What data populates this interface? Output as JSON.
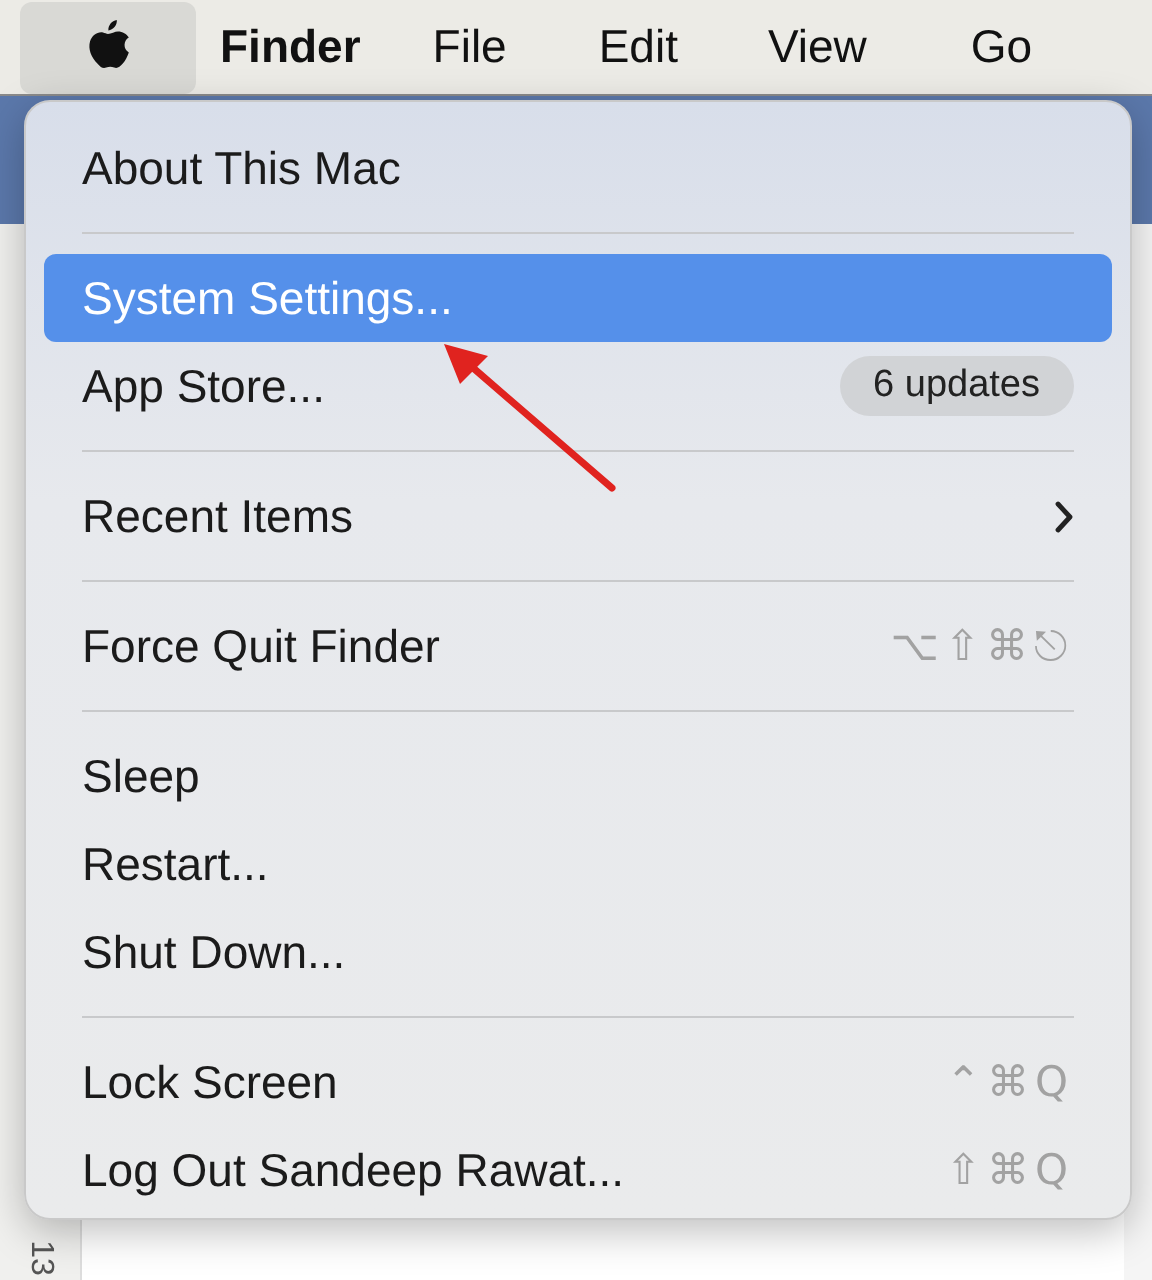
{
  "menu_bar": {
    "items": [
      {
        "label": "Finder",
        "kind": "app"
      },
      {
        "label": "File",
        "kind": "menu"
      },
      {
        "label": "Edit",
        "kind": "menu"
      },
      {
        "label": "View",
        "kind": "menu"
      },
      {
        "label": "Go",
        "kind": "menu"
      }
    ]
  },
  "background_window": {
    "ruler_labels": [
      "13"
    ]
  },
  "apple_menu": {
    "sections": [
      [
        {
          "label": "About This Mac",
          "kind": "plain",
          "selected": false
        }
      ],
      [
        {
          "label": "System Settings...",
          "kind": "plain",
          "selected": true
        },
        {
          "label": "App Store...",
          "kind": "badge",
          "badge": "6 updates",
          "selected": false
        }
      ],
      [
        {
          "label": "Recent Items",
          "kind": "submenu",
          "selected": false
        }
      ],
      [
        {
          "label": "Force Quit Finder",
          "kind": "shortcut",
          "shortcut": "⌥⇧⌘⎋",
          "selected": false
        }
      ],
      [
        {
          "label": "Sleep",
          "kind": "plain",
          "selected": false
        },
        {
          "label": "Restart...",
          "kind": "plain",
          "selected": false
        },
        {
          "label": "Shut Down...",
          "kind": "plain",
          "selected": false
        }
      ],
      [
        {
          "label": "Lock Screen",
          "kind": "shortcut",
          "shortcut": "⌃⌘Q",
          "selected": false
        },
        {
          "label": "Log Out Sandeep Rawat...",
          "kind": "shortcut",
          "shortcut": "⇧⌘Q",
          "selected": false
        }
      ]
    ]
  }
}
